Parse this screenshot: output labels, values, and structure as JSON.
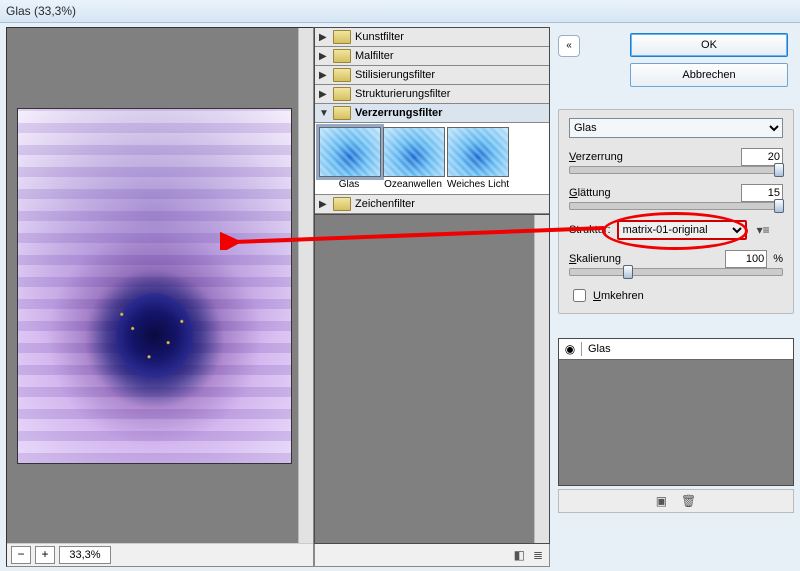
{
  "window": {
    "title": "Glas (33,3%)"
  },
  "preview": {
    "zoom": "33,3%"
  },
  "tree": {
    "items": [
      {
        "label": "Kunstfilter",
        "expanded": false
      },
      {
        "label": "Malfilter",
        "expanded": false
      },
      {
        "label": "Stilisierungsfilter",
        "expanded": false
      },
      {
        "label": "Strukturierungsfilter",
        "expanded": false
      },
      {
        "label": "Verzerrungsfilter",
        "expanded": true
      },
      {
        "label": "Zeichenfilter",
        "expanded": false
      }
    ],
    "thumbs": [
      {
        "label": "Glas",
        "selected": true
      },
      {
        "label": "Ozeanwellen",
        "selected": false
      },
      {
        "label": "Weiches Licht",
        "selected": false
      }
    ]
  },
  "buttons": {
    "ok": "OK",
    "cancel": "Abbrechen"
  },
  "controls": {
    "filter_select": "Glas",
    "verzerrung": {
      "label": "Verzerrung",
      "value": "20",
      "knob_pct": 100
    },
    "glaettung": {
      "label": "Glättung",
      "value": "15",
      "knob_pct": 100
    },
    "struktur": {
      "label": "Struktur:",
      "value": "matrix-01-original"
    },
    "skalierung": {
      "label": "Skalierung",
      "value": "100",
      "unit": "%",
      "knob_pct": 25
    },
    "umkehren": {
      "label": "Umkehren",
      "checked": false
    }
  },
  "fx": {
    "items": [
      {
        "name": "Glas",
        "visible": true
      }
    ]
  }
}
